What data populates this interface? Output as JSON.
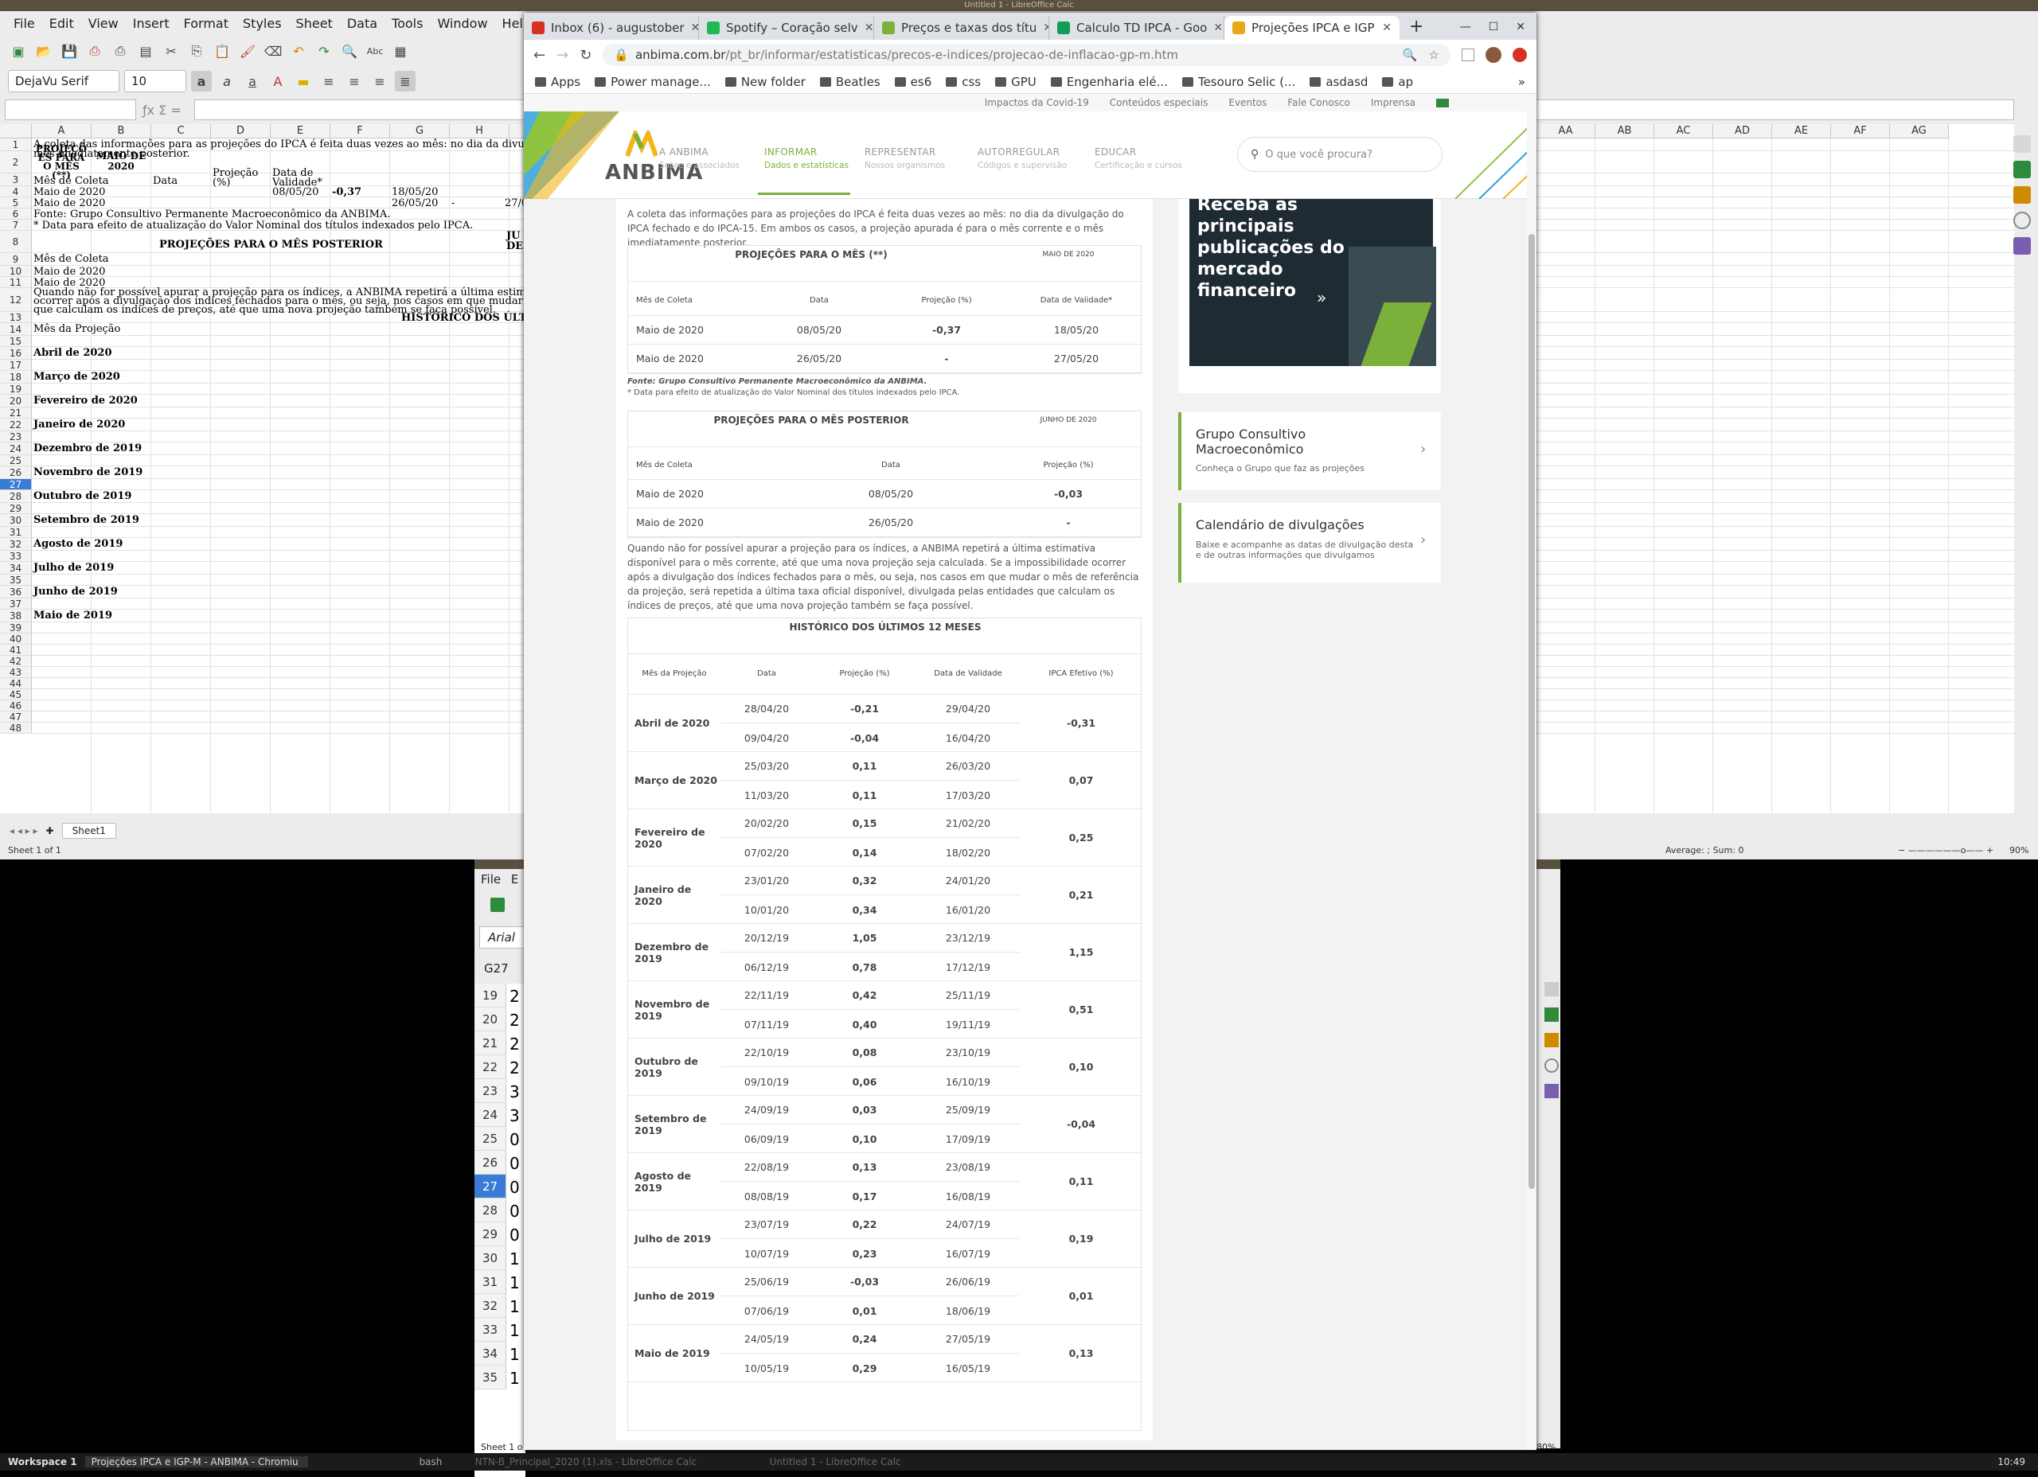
{
  "calc": {
    "title": "Untitled 1 - LibreOffice Calc",
    "menu": [
      "File",
      "Edit",
      "View",
      "Insert",
      "Format",
      "Styles",
      "Sheet",
      "Data",
      "Tools",
      "Window",
      "Help"
    ],
    "font_name": "DejaVu Serif",
    "font_size": "10",
    "columns": [
      "A",
      "B",
      "C",
      "D",
      "E",
      "F",
      "G",
      "H"
    ],
    "right_columns": [
      "AA",
      "AB",
      "AC",
      "AD",
      "AE",
      "AF",
      "AG"
    ],
    "rows": [
      "1",
      "2",
      "3",
      "4",
      "5",
      "6",
      "7",
      "8",
      "9",
      "10",
      "11",
      "12",
      "13",
      "14",
      "15",
      "16",
      "17",
      "18",
      "19",
      "20",
      "21",
      "22",
      "23",
      "24",
      "25",
      "26",
      "27",
      "28",
      "29",
      "30",
      "31",
      "32",
      "33",
      "34",
      "35",
      "36",
      "37",
      "38",
      "39",
      "40",
      "41",
      "42",
      "43",
      "44",
      "45",
      "46",
      "47",
      "48"
    ],
    "cells": {
      "a1": "A coleta das informações para as projeções do IPCA é feita duas vezes ao mês: no dia da divulgação",
      "a1b": "mês imediatamente posterior.",
      "a2": "PROJEÇÕ ES PARA O MÊS (**)",
      "b2": "MAIO DE 2020",
      "a3": "Mês de Coleta",
      "b3": "Data",
      "d3": "Projeção (%)",
      "e3": "Data de Validade*",
      "a4": "Maio de 2020",
      "e4": "08/05/20",
      "f4": "-0,37",
      "g4": "18/05/20",
      "a5": "Maio de 2020",
      "g5": "26/05/20",
      "h5": "-",
      "i5": "27/0",
      "a6": "Fonte: Grupo Consultivo Permanente Macroeconômico da ANBIMA.",
      "a7": "* Data para efeito de atualização do Valor Nominal dos títulos indexados pelo IPCA.",
      "a8": "PROJEÇÕES PARA O MÊS POSTERIOR",
      "i8": "JU DE",
      "a9": "Mês de Coleta",
      "a10": "Maio de 2020",
      "a11": "Maio de 2020",
      "a12": "Quando não for possível apurar a projeção para os índices, a ANBIMA repetirá a última estimativa d",
      "a12b": "ocorrer após a divulgação dos índices fechados para o mês, ou seja, nos casos em que mudar o mês",
      "a12c": "que calculam os índices de preços, até que uma nova projeção também se faça possível.",
      "a13": "HISTÓRICO DOS ÚLTI",
      "a14": "Mês da Projeção",
      "a16": "Abril de 2020",
      "a18": "Março de 2020",
      "a20": "Fevereiro de 2020",
      "a22": "Janeiro de 2020",
      "a24": "Dezembro de 2019",
      "a26": "Novembro de 2019",
      "a28": "Outubro de 2019",
      "a30": "Setembro de 2019",
      "a32": "Agosto de 2019",
      "a34": "Julho de 2019",
      "a36": "Junho de 2019",
      "a38": "Maio de 2019"
    },
    "sheet_tab": "Sheet1",
    "status_left": "Sheet 1 of 1",
    "status_mid": "Average: ; Sum: 0",
    "zoom": "90%"
  },
  "calc2": {
    "menu": [
      "File",
      "E"
    ],
    "font_name": "Arial",
    "name_box": "G27",
    "rows": [
      "19",
      "20",
      "21",
      "22",
      "23",
      "24",
      "25",
      "26",
      "27",
      "28",
      "29",
      "30",
      "31",
      "32",
      "33",
      "34",
      "35"
    ],
    "row_values": [
      "2",
      "2",
      "2",
      "2",
      "3",
      "3",
      "0",
      "0",
      "0",
      "0",
      "0",
      "1",
      "1",
      "1",
      "1",
      "1",
      "1"
    ],
    "status_left": "Sheet 1 o",
    "zoom": "80%"
  },
  "taskbar": {
    "workspace": "Workspace 1",
    "items": [
      "Projeções IPCA e IGP-M - ANBIMA - Chromiu",
      "bash",
      "NTN-B_Principal_2020 (1).xls - LibreOffice Calc",
      "Untitled 1 - LibreOffice Calc"
    ],
    "clock": "10:49"
  },
  "browser": {
    "tabs": [
      {
        "label": "Inbox (6) - augustober",
        "color": "#d93025"
      },
      {
        "label": "Spotify – Coração selv",
        "color": "#1db954"
      },
      {
        "label": "Preços e taxas dos títu",
        "color": "#7bb13a"
      },
      {
        "label": "Calculo TD IPCA - Goo",
        "color": "#0f9d58"
      },
      {
        "label": "Projeções IPCA e IGP",
        "color": "#e8a917"
      }
    ],
    "url_domain": "anbima.com.br",
    "url_path": "/pt_br/informar/estatisticas/precos-e-indices/projecao-de-inflacao-gp-m.htm",
    "bookmarks": [
      "Apps",
      "Power manage...",
      "New folder",
      "Beatles",
      "es6",
      "css",
      "GPU",
      "Engenharia elé...",
      "Tesouro Selic (...",
      "asdasd",
      "ap"
    ],
    "top_links": [
      "Impactos da Covid-19",
      "Conteúdos especiais",
      "Eventos",
      "Fale Conosco",
      "Imprensa"
    ],
    "logo": "ANBIMA",
    "nav": [
      {
        "label": "A ANBIMA",
        "sub": "Sobre e associados"
      },
      {
        "label": "INFORMAR",
        "sub": "Dados e estatísticas"
      },
      {
        "label": "REPRESENTAR",
        "sub": "Nossos organismos"
      },
      {
        "label": "AUTORREGULAR",
        "sub": "Códigos e supervisão"
      },
      {
        "label": "EDUCAR",
        "sub": "Certificação e cursos"
      }
    ],
    "search_placeholder": "O que você procura?"
  },
  "page": {
    "intro": "A coleta das informações para as projeções do IPCA é feita duas vezes ao mês: no dia da divulgação do IPCA fechado e do IPCA-15. Em ambos os casos, a projeção apurada é para o mês corrente e o mês imediatamente posterior.",
    "t1": {
      "title": "PROJEÇÕES PARA O MÊS (**)",
      "month": "MAIO DE 2020",
      "headers": [
        "Mês de Coleta",
        "Data",
        "Projeção (%)",
        "Data de Validade*"
      ],
      "rows": [
        [
          "Maio de 2020",
          "08/05/20",
          "-0,37",
          "18/05/20"
        ],
        [
          "Maio de 2020",
          "26/05/20",
          "-",
          "27/05/20"
        ]
      ]
    },
    "fonte": "Fonte: Grupo Consultivo Permanente Macroeconômico da ANBIMA.",
    "note": "* Data para efeito de atualização do Valor Nominal dos títulos indexados pelo IPCA.",
    "t2": {
      "title": "PROJEÇÕES PARA O MÊS POSTERIOR",
      "month": "JUNHO DE 2020",
      "headers": [
        "Mês de Coleta",
        "Data",
        "Projeção (%)"
      ],
      "rows": [
        [
          "Maio de 2020",
          "08/05/20",
          "-0,03"
        ],
        [
          "Maio de 2020",
          "26/05/20",
          "-"
        ]
      ]
    },
    "para": "Quando não for possível apurar a projeção para os índices, a ANBIMA repetirá a última estimativa disponível para o mês corrente, até que uma nova projeção seja calculada. Se a impossibilidade ocorrer após a divulgação dos índices fechados para o mês, ou seja, nos casos em que mudar o mês de referência da projeção, será repetida a última taxa oficial disponível, divulgada pelas entidades que calculam os índices de preços, até que uma nova projeção também se faça possível.",
    "t3": {
      "title": "HISTÓRICO DOS ÚLTIMOS 12 MESES",
      "headers": [
        "Mês da Projeção",
        "Data",
        "Projeção (%)",
        "Data de Validade",
        "IPCA Efetivo (%)"
      ],
      "groups": [
        {
          "month": "Abril de 2020",
          "ipca": "-0,31",
          "rows": [
            [
              "28/04/20",
              "-0,21",
              "29/04/20"
            ],
            [
              "09/04/20",
              "-0,04",
              "16/04/20"
            ]
          ]
        },
        {
          "month": "Março de 2020",
          "ipca": "0,07",
          "rows": [
            [
              "25/03/20",
              "0,11",
              "26/03/20"
            ],
            [
              "11/03/20",
              "0,11",
              "17/03/20"
            ]
          ]
        },
        {
          "month": "Fevereiro de 2020",
          "ipca": "0,25",
          "rows": [
            [
              "20/02/20",
              "0,15",
              "21/02/20"
            ],
            [
              "07/02/20",
              "0,14",
              "18/02/20"
            ]
          ]
        },
        {
          "month": "Janeiro de 2020",
          "ipca": "0,21",
          "rows": [
            [
              "23/01/20",
              "0,32",
              "24/01/20"
            ],
            [
              "10/01/20",
              "0,34",
              "16/01/20"
            ]
          ]
        },
        {
          "month": "Dezembro de 2019",
          "ipca": "1,15",
          "rows": [
            [
              "20/12/19",
              "1,05",
              "23/12/19"
            ],
            [
              "06/12/19",
              "0,78",
              "17/12/19"
            ]
          ]
        },
        {
          "month": "Novembro de 2019",
          "ipca": "0,51",
          "rows": [
            [
              "22/11/19",
              "0,42",
              "25/11/19"
            ],
            [
              "07/11/19",
              "0,40",
              "19/11/19"
            ]
          ]
        },
        {
          "month": "Outubro de 2019",
          "ipca": "0,10",
          "rows": [
            [
              "22/10/19",
              "0,08",
              "23/10/19"
            ],
            [
              "09/10/19",
              "0,06",
              "16/10/19"
            ]
          ]
        },
        {
          "month": "Setembro de 2019",
          "ipca": "-0,04",
          "rows": [
            [
              "24/09/19",
              "0,03",
              "25/09/19"
            ],
            [
              "06/09/19",
              "0,10",
              "17/09/19"
            ]
          ]
        },
        {
          "month": "Agosto de 2019",
          "ipca": "0,11",
          "rows": [
            [
              "22/08/19",
              "0,13",
              "23/08/19"
            ],
            [
              "08/08/19",
              "0,17",
              "16/08/19"
            ]
          ]
        },
        {
          "month": "Julho de 2019",
          "ipca": "0,19",
          "rows": [
            [
              "23/07/19",
              "0,22",
              "24/07/19"
            ],
            [
              "10/07/19",
              "0,23",
              "16/07/19"
            ]
          ]
        },
        {
          "month": "Junho de 2019",
          "ipca": "0,01",
          "rows": [
            [
              "25/06/19",
              "-0,03",
              "26/06/19"
            ],
            [
              "07/06/19",
              "0,01",
              "18/06/19"
            ]
          ]
        },
        {
          "month": "Maio de 2019",
          "ipca": "0,13",
          "rows": [
            [
              "24/05/19",
              "0,24",
              "27/05/19"
            ],
            [
              "10/05/19",
              "0,29",
              "16/05/19"
            ]
          ]
        }
      ]
    },
    "promo": "Receba as principais publicações do mercado financeiro",
    "card1": {
      "title": "Grupo Consultivo Macroeconômico",
      "desc": "Conheça o Grupo que faz as projeções"
    },
    "card2": {
      "title": "Calendário de divulgações",
      "desc": "Baixe e acompanhe as datas de divulgação desta e de outras informações que divulgamos"
    }
  }
}
